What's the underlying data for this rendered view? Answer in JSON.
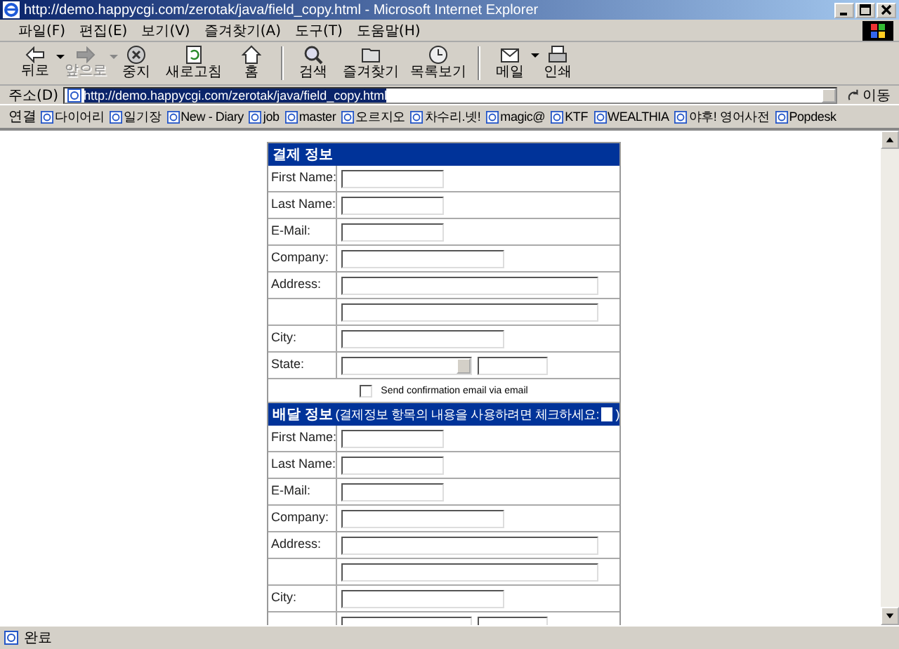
{
  "window": {
    "title": "http://demo.happycgi.com/zerotak/java/field_copy.html - Microsoft Internet Explorer"
  },
  "menu": [
    "파일(F)",
    "편집(E)",
    "보기(V)",
    "즐겨찾기(A)",
    "도구(T)",
    "도움말(H)"
  ],
  "toolbar": [
    {
      "label": "뒤로",
      "kind": "back",
      "disabled": false,
      "dropdown": true
    },
    {
      "label": "앞으로",
      "kind": "forward",
      "disabled": true,
      "dropdown": true
    },
    {
      "label": "중지",
      "kind": "stop",
      "disabled": false,
      "dropdown": false
    },
    {
      "label": "새로고침",
      "kind": "refresh",
      "disabled": false,
      "dropdown": false
    },
    {
      "label": "홈",
      "kind": "home",
      "disabled": false,
      "dropdown": false
    },
    {
      "label": "검색",
      "kind": "search",
      "disabled": false,
      "dropdown": false
    },
    {
      "label": "즐겨찾기",
      "kind": "favorites",
      "disabled": false,
      "dropdown": false
    },
    {
      "label": "목록보기",
      "kind": "history",
      "disabled": false,
      "dropdown": false
    },
    {
      "label": "메일",
      "kind": "mail",
      "disabled": false,
      "dropdown": true
    },
    {
      "label": "인쇄",
      "kind": "print",
      "disabled": false,
      "dropdown": false
    }
  ],
  "address": {
    "label": "주소(D)",
    "value": "http://demo.happycgi.com/zerotak/java/field_copy.html",
    "go": "이동"
  },
  "links": {
    "label": "연결",
    "items": [
      "다이어리",
      "일기장",
      "New - Diary",
      "job",
      "master",
      "오르지오",
      "차수리.넷!",
      "magic@",
      "KTF",
      "WEALTHIA",
      "야후! 영어사전",
      "Popdesk"
    ]
  },
  "billing": {
    "title": "결제 정보",
    "rows": [
      {
        "label": "First Name:",
        "kind": "short"
      },
      {
        "label": "Last Name:",
        "kind": "short"
      },
      {
        "label": "E-Mail:",
        "kind": "short"
      },
      {
        "label": "Company:",
        "kind": "medium"
      },
      {
        "label": "Address:",
        "kind": "long"
      },
      {
        "kind": "long"
      },
      {
        "label": "City:",
        "kind": "medium"
      },
      {
        "label": "State:",
        "kind": "state"
      }
    ]
  },
  "confirm": {
    "checked": false,
    "text": "Send confirmation email via email"
  },
  "shipping": {
    "title": "배달 정보",
    "note": "(결제정보 항목의 내용을 사용하려면 체크하세요:",
    "note_end": ")",
    "same_checked": false,
    "rows": [
      {
        "label": "First Name:",
        "kind": "short"
      },
      {
        "label": "Last Name:",
        "kind": "short"
      },
      {
        "label": "E-Mail:",
        "kind": "short"
      },
      {
        "label": "Company:",
        "kind": "medium"
      },
      {
        "label": "Address:",
        "kind": "long"
      },
      {
        "kind": "long"
      },
      {
        "label": "City:",
        "kind": "medium"
      },
      {
        "kind": "state"
      }
    ]
  },
  "status": {
    "text": "완료"
  }
}
